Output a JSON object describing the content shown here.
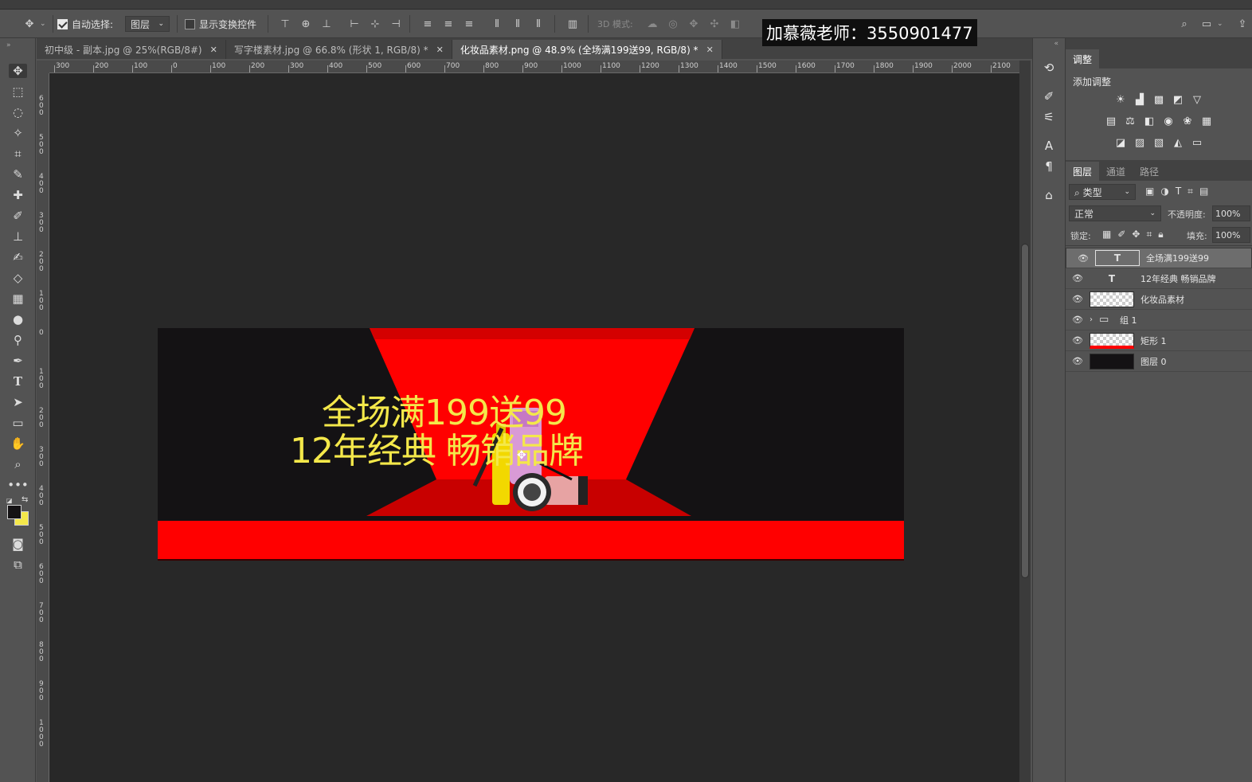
{
  "options_bar": {
    "auto_select_label": "自动选择:",
    "auto_select_value": "图层",
    "show_transform_label": "显示变换控件",
    "mode_3d_label": "3D 模式:"
  },
  "watermark": "加慕薇老师：3550901477",
  "tabs": [
    {
      "label": "初中级 - 副本.jpg @ 25%(RGB/8#)"
    },
    {
      "label": "写字楼素材.jpg @ 66.8% (形状 1, RGB/8) *"
    },
    {
      "label": "化妆品素材.png @ 48.9% (全场满199送99, RGB/8) *"
    }
  ],
  "ruler": {
    "h_labels": [
      "300",
      "200",
      "100",
      "0",
      "100",
      "200",
      "300",
      "400",
      "500",
      "600",
      "700",
      "800",
      "900",
      "1000",
      "1100",
      "1200",
      "1300",
      "1400",
      "1500",
      "1600",
      "1700",
      "1800",
      "1900",
      "2000",
      "2100"
    ],
    "v_labels": [
      "6 0 0",
      "5 0 0",
      "4 0 0",
      "3 0 0",
      "2 0 0",
      "1 0 0",
      "0",
      "1 0 0",
      "2 0 0",
      "3 0 0",
      "4 0 0",
      "5 0 0",
      "6 0 0",
      "7 0 0",
      "8 0 0",
      "9 0 0",
      "1 0 0 0"
    ]
  },
  "canvas": {
    "line1": "全场满199送99",
    "line2": "12年经典  畅销品牌"
  },
  "colors": {
    "banner_bg": "#141214",
    "stage_red": "#ff0000",
    "dark_red": "#c80000",
    "text_yellow": "#f4e84a"
  },
  "adjust_panel": {
    "tab_adjust": "调整",
    "add_adjust": "添加调整"
  },
  "layers_panel": {
    "tabs": [
      "图层",
      "通道",
      "路径"
    ],
    "filter_label": "类型",
    "blend_mode": "正常",
    "opacity_label": "不透明度:",
    "opacity_value": "100%",
    "lock_label": "锁定:",
    "fill_label": "填充:",
    "fill_value": "100%",
    "layers": [
      {
        "name": "全场满199送99",
        "kind": "text",
        "selected": true
      },
      {
        "name": "12年经典  畅销品牌",
        "kind": "text",
        "selected": false
      },
      {
        "name": "化妆品素材",
        "kind": "image",
        "selected": false
      },
      {
        "name": "组 1",
        "kind": "group",
        "selected": false
      },
      {
        "name": "矩形 1",
        "kind": "shape",
        "selected": false
      },
      {
        "name": "图层 0",
        "kind": "fill",
        "selected": false
      }
    ]
  }
}
